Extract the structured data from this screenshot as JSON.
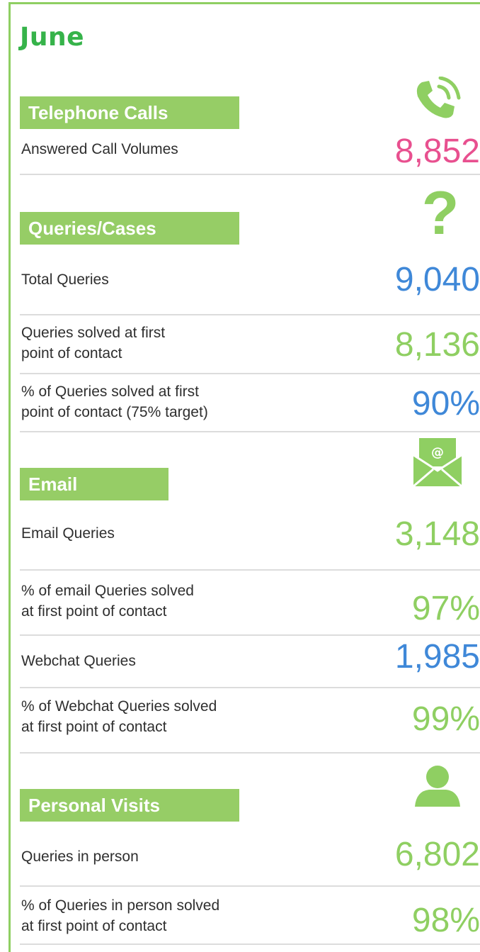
{
  "title": "June",
  "sections": [
    {
      "header": "Telephone Calls",
      "icon": "phone-icon",
      "rows": [
        {
          "label": [
            "Answered Call Volumes"
          ],
          "value": "8,852",
          "color": "#e8508f"
        }
      ]
    },
    {
      "header": "Queries/Cases",
      "icon": "question-mark-icon",
      "rows": [
        {
          "label": [
            "Total Queries"
          ],
          "value": "9,040",
          "color": "#3f88d8"
        },
        {
          "label": [
            "Queries solved at first",
            "point of contact"
          ],
          "value": "8,136",
          "color": "#8fcf62"
        },
        {
          "label": [
            "% of Queries solved at first",
            "point of contact (75% target)"
          ],
          "value": "90%",
          "color": "#3f88d8"
        }
      ]
    },
    {
      "header": "Email",
      "icon": "email-icon",
      "rows": [
        {
          "label": [
            "Email Queries"
          ],
          "value": "3,148",
          "color": "#8fcf62"
        },
        {
          "label": [
            "% of email Queries solved",
            "at first point of contact"
          ],
          "value": "97%",
          "color": "#8fcf62"
        },
        {
          "label": [
            "Webchat Queries"
          ],
          "value": "1,985",
          "color": "#3f88d8"
        },
        {
          "label": [
            "% of Webchat Queries solved",
            "at first point of contact"
          ],
          "value": "99%",
          "color": "#8fcf62"
        }
      ]
    },
    {
      "header": "Personal Visits",
      "icon": "person-icon",
      "rows": [
        {
          "label": [
            "Queries in person"
          ],
          "value": "6,802",
          "color": "#8fcf62"
        },
        {
          "label": [
            "% of Queries in person solved",
            "at first point of contact"
          ],
          "value": "98%",
          "color": "#8fcf62"
        }
      ]
    }
  ],
  "colors": {
    "accent_green": "#8fcf62",
    "title_green": "#36b34a",
    "pink": "#e8508f",
    "blue": "#3f88d8"
  }
}
